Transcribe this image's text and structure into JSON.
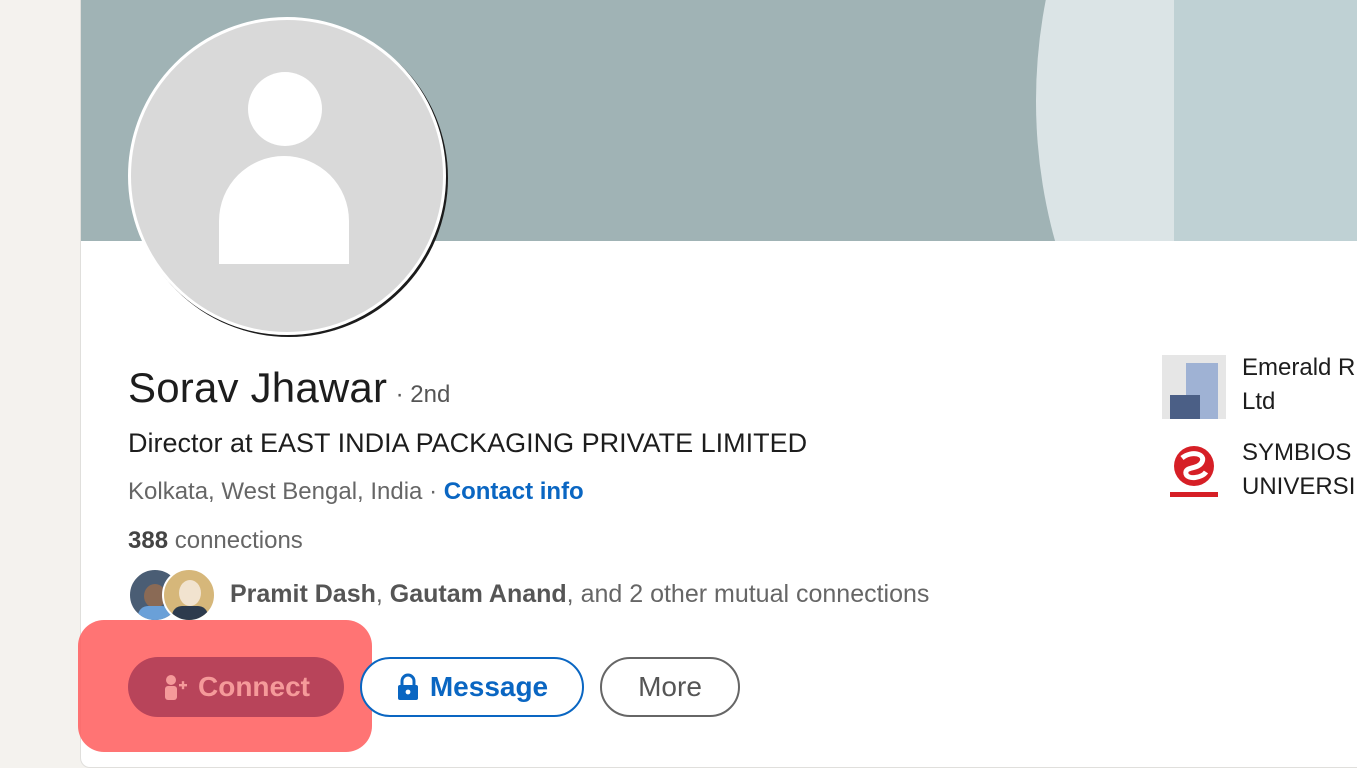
{
  "profile": {
    "name": "Sorav Jhawar",
    "degree": "· 2nd",
    "headline": "Director at EAST INDIA PACKAGING PRIVATE LIMITED",
    "location": "Kolkata, West Bengal, India",
    "location_separator": " · ",
    "contact_info_label": "Contact info",
    "connections_count": "388",
    "connections_label": " connections"
  },
  "mutual": {
    "name1": "Pramit Dash",
    "separator": ", ",
    "name2": "Gautam Anand",
    "rest": ", and 2 other mutual connections"
  },
  "actions": {
    "connect_label": "Connect",
    "message_label": "Message",
    "more_label": "More"
  },
  "organizations": [
    {
      "line1": "Emerald R",
      "line2": "Ltd",
      "icon": "company-logo"
    },
    {
      "line1": "SYMBIOS",
      "line2": "UNIVERSI",
      "icon": "university-logo"
    }
  ],
  "colors": {
    "link": "#0a66c2",
    "banner": "#a0b3b5",
    "highlight": "#ff5c5c",
    "connect_bg": "#b8445a"
  }
}
